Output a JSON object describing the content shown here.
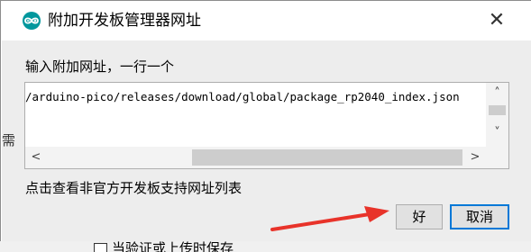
{
  "dialog": {
    "title": "附加开发板管理器网址",
    "close_label": "✕",
    "app_icon": "arduino-icon",
    "prompt": "输入附加网址，一行一个",
    "url_value": "/arduino-pico/releases/download/global/package_rp2040_index.json",
    "help_link": "点击查看非官方开发板支持网址列表",
    "ok_label": "好",
    "cancel_label": "取消"
  },
  "scrollbars": {
    "up": "˄",
    "down": "˅",
    "left": "<",
    "right": ">"
  },
  "background": {
    "left_peek": "需",
    "checkbox_label": "当验证或上传时保存"
  },
  "colors": {
    "accent": "#0078d7",
    "arduino_teal": "#00979d",
    "annotation_arrow": "#e8332a"
  }
}
